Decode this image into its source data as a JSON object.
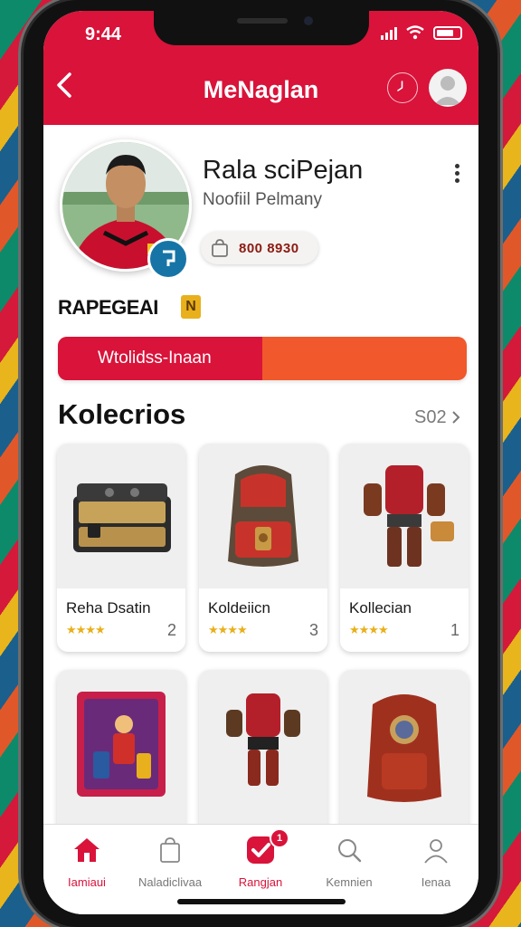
{
  "status": {
    "time": "9:44"
  },
  "header": {
    "title": "MeNaglan"
  },
  "profile": {
    "name": "Rala sciPejan",
    "subtitle": "Noofiil Pelmany",
    "coins": "800 8930",
    "rank_label": "RAPEGEAI",
    "rank_badge": "N"
  },
  "progress": {
    "label": "Wtolidss-Inaan",
    "fraction": 0.5
  },
  "collections": {
    "title": "Kolecrios",
    "see_all": "S02",
    "items": [
      {
        "name": "Reha Dsatin",
        "stars": "★★★★",
        "count": "2"
      },
      {
        "name": "Koldeiicn",
        "stars": "★★★★",
        "count": "3"
      },
      {
        "name": "Kollecian",
        "stars": "★★★★",
        "count": "1"
      },
      {
        "name": "",
        "stars": "",
        "count": ""
      },
      {
        "name": "",
        "stars": "",
        "count": ""
      },
      {
        "name": "",
        "stars": "",
        "count": ""
      }
    ]
  },
  "nav": [
    {
      "label": "Iamiaui"
    },
    {
      "label": "Naladiclivaa"
    },
    {
      "label": "Rangjan",
      "badge": "1"
    },
    {
      "label": "Kemnien"
    },
    {
      "label": "Ienaa"
    }
  ],
  "colors": {
    "primary": "#d9133a",
    "accent": "#f1582b",
    "gold": "#e8b01c",
    "badge_blue": "#1675a6"
  }
}
